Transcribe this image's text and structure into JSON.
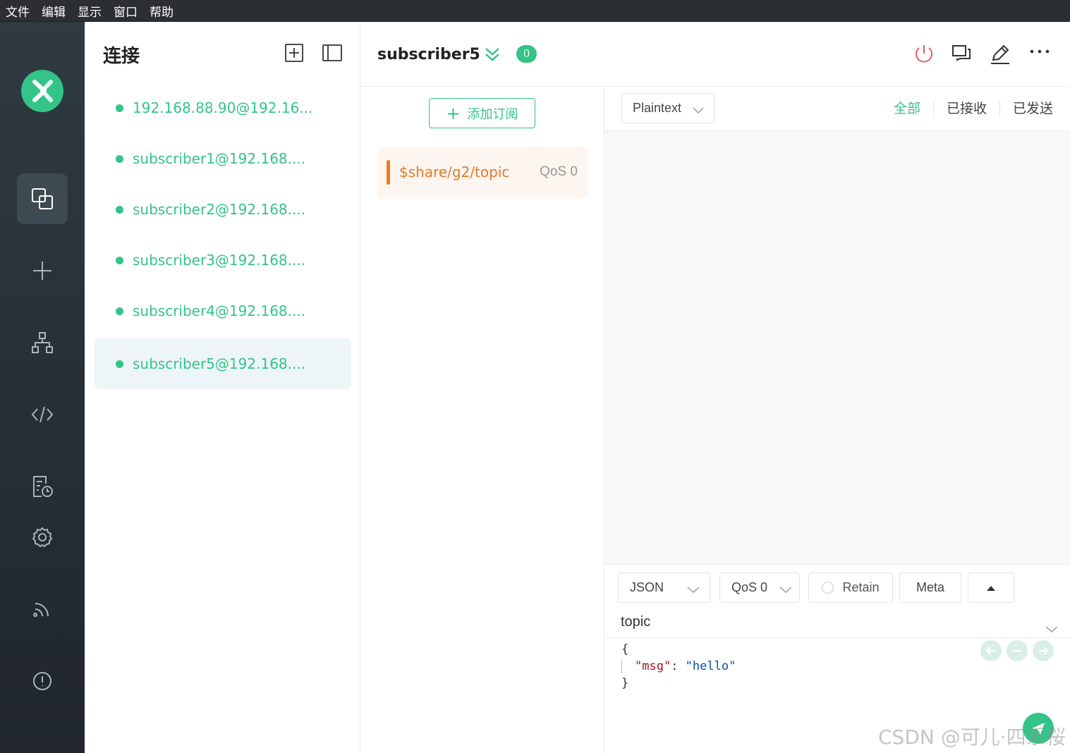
{
  "menu": [
    "文件",
    "编辑",
    "显示",
    "窗口",
    "帮助"
  ],
  "connections_panel": {
    "title": "连接",
    "items": [
      {
        "label": "192.168.88.90@192.16...",
        "status": "connected"
      },
      {
        "label": "subscriber1@192.168....",
        "status": "connected"
      },
      {
        "label": "subscriber2@192.168....",
        "status": "connected"
      },
      {
        "label": "subscriber3@192.168....",
        "status": "connected"
      },
      {
        "label": "subscriber4@192.168....",
        "status": "connected"
      },
      {
        "label": "subscriber5@192.168....",
        "status": "connected",
        "active": true
      }
    ]
  },
  "header": {
    "title": "subscriber5",
    "badge": "0"
  },
  "subscriptions": {
    "add_label": "添加订阅",
    "items": [
      {
        "topic": "$share/g2/topic",
        "qos": "QoS 0",
        "color": "#ef7d1c"
      }
    ]
  },
  "messages": {
    "format": "Plaintext",
    "tabs": [
      "全部",
      "已接收",
      "已发送"
    ],
    "active_tab": "全部"
  },
  "compose": {
    "format": "JSON",
    "qos": "QoS 0",
    "retain": "Retain",
    "meta": "Meta",
    "topic": "topic",
    "payload": {
      "open": "{",
      "key": "\"msg\"",
      "colon": ": ",
      "value": "\"hello\"",
      "close": "}"
    }
  },
  "watermark": "CSDN @可儿·四系桜",
  "colors": {
    "accent": "#34c388",
    "topic": "#ef7d1c",
    "disconnect": "#e55c5c"
  }
}
